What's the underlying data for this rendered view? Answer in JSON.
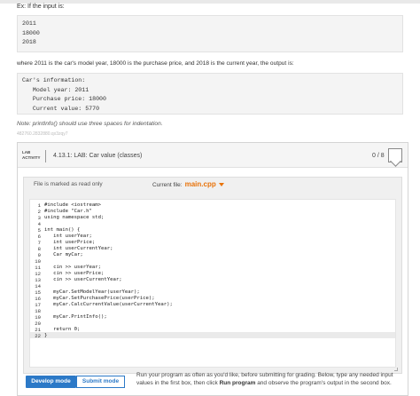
{
  "example": {
    "intro": "Ex: If the input is:",
    "input_lines": [
      "2011",
      "18000",
      "2018"
    ],
    "explanation": "where 2011 is the car's model year, 18000 is the purchase price, and 2018 is the current year, the output is:",
    "output_lines": [
      "Car's information:",
      "   Model year: 2011",
      "   Purchase price: 18000",
      "   Current value: 5770"
    ],
    "note": "Note: printInfo() should use three spaces for indentation.",
    "code_id": "482760.2832880.qx3zqy7"
  },
  "lab": {
    "badge_line1": "LAB",
    "badge_line2": "ACTIVITY",
    "title": "4.13.1: LAB: Car value (classes)",
    "score": "0 / 8",
    "readonly_label": "File is marked as read only",
    "current_file_label": "Current file:",
    "current_file_name": "main.cpp",
    "line_numbers": [
      "1",
      "2",
      "3",
      "4",
      "5",
      "6",
      "7",
      "8",
      "9",
      "10",
      "11",
      "12",
      "13",
      "14",
      "15",
      "16",
      "17",
      "18",
      "19",
      "20",
      "21",
      "22"
    ],
    "code_lines": [
      "#include <iostream>",
      "#include \"Car.h\"",
      "using namespace std;",
      "",
      "int main() {",
      "   int userYear;",
      "   int userPrice;",
      "   int userCurrentYear;",
      "   Car myCar;",
      "",
      "   cin >> userYear;",
      "   cin >> userPrice;",
      "   cin >> userCurrentYear;",
      "",
      "   myCar.SetModelYear(userYear);",
      "   myCar.SetPurchasePrice(userPrice);",
      "   myCar.CalcCurrentValue(userCurrentYear);",
      "",
      "   myCar.PrintInfo();",
      "",
      "   return 0;",
      "}"
    ],
    "develop_mode": "Develop mode",
    "submit_mode": "Submit mode",
    "mode_desc_pre": "Run your program as often as you'd like, before submitting for grading. Below, type any needed input values in the first box, then click ",
    "mode_desc_bold": "Run program",
    "mode_desc_post": " and observe the program's output in the second box."
  }
}
